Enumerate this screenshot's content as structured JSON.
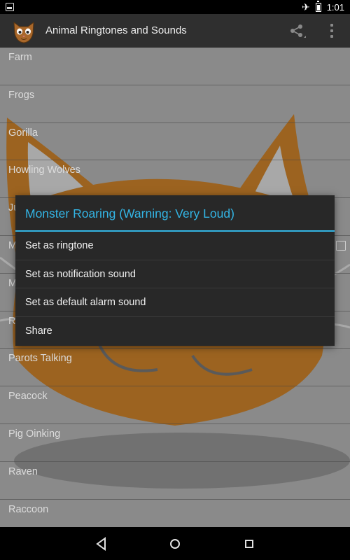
{
  "status_bar": {
    "time": "1:01",
    "icons": [
      "notification-icon",
      "airplane-mode-icon",
      "battery-icon"
    ]
  },
  "app_bar": {
    "title": "Animal Ringtones and Sounds",
    "icons": [
      "cat-logo-icon",
      "share-icon",
      "overflow-menu-icon"
    ]
  },
  "sound_list": [
    "Farm",
    "Frogs",
    "Gorilla",
    "Howling Wolves",
    "Ju",
    "M",
    "M",
    "R",
    "Parots Talking",
    "Peacock",
    "Pig Oinking",
    "Raven",
    "Raccoon"
  ],
  "dialog": {
    "title": "Monster Roaring (Warning: Very Loud)",
    "items": [
      "Set as ringtone",
      "Set as notification sound",
      "Set as default alarm sound",
      "Share"
    ]
  },
  "nav_bar": {
    "icons": [
      "back-icon",
      "home-icon",
      "recents-icon"
    ]
  },
  "colors": {
    "accent": "#33b5e5",
    "action_bar": "#2f2f2f",
    "dialog_bg": "#282828",
    "list_bg": "#8a8a8a",
    "cat_orange": "#9c6320"
  }
}
